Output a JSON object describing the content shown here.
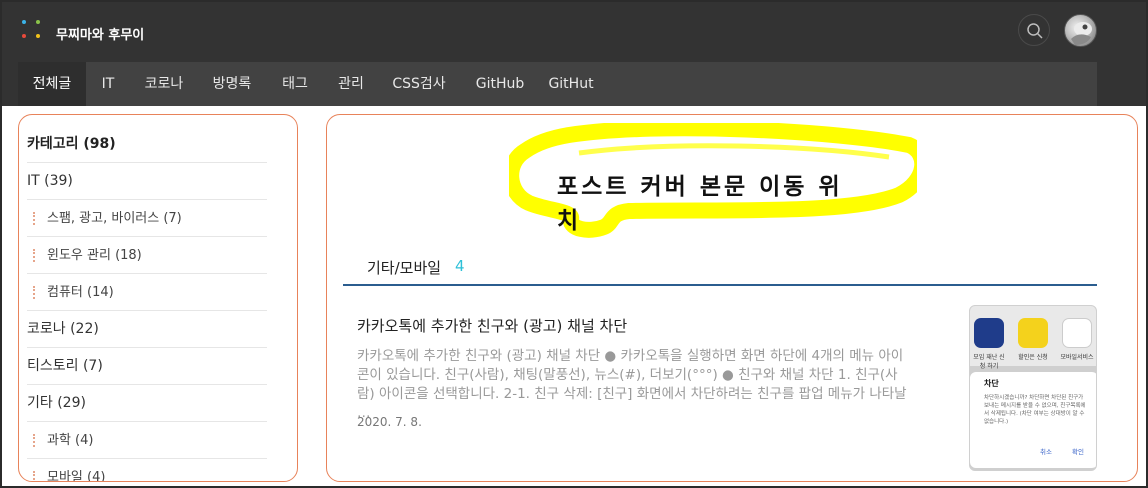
{
  "header": {
    "site_title": "무찌마와 후무이",
    "nav": [
      {
        "label": "전체글",
        "active": true
      },
      {
        "label": "IT"
      },
      {
        "label": "코로나"
      },
      {
        "label": "방명록"
      },
      {
        "label": "태그"
      },
      {
        "label": "관리"
      },
      {
        "label": "CSS검사"
      },
      {
        "label": "GitHub"
      },
      {
        "label": "GitHut"
      }
    ],
    "icons": {
      "search": "search-icon",
      "avatar": "avatar-image"
    }
  },
  "sidebar": {
    "categories": [
      {
        "label": "카테고리 (98)",
        "level": 0,
        "header": true
      },
      {
        "label": "IT (39)",
        "level": 0
      },
      {
        "label": "스팸, 광고, 바이러스 (7)",
        "level": 1
      },
      {
        "label": "윈도우 관리 (18)",
        "level": 1
      },
      {
        "label": "컴퓨터 (14)",
        "level": 1
      },
      {
        "label": "코로나 (22)",
        "level": 0
      },
      {
        "label": "티스토리 (7)",
        "level": 0
      },
      {
        "label": "기타 (29)",
        "level": 0
      },
      {
        "label": "과학 (4)",
        "level": 1
      },
      {
        "label": "모바일 (4)",
        "level": 1
      }
    ]
  },
  "main": {
    "cover_text": "포스트 커버 본문 이동 위치",
    "section": {
      "title": "기타/모바일",
      "count": "4"
    },
    "post": {
      "title": "카카오톡에 추가한 친구와 (광고) 채널 차단",
      "excerpt": "카카오톡에 추가한 친구와 (광고) 채널 차단 ● 카카오톡을 실행하면 화면 하단에 4개의 메뉴 아이콘이 있습니다. 친구(사람), 채팅(말풍선), 뉴스(#), 더보기(°°°) ● 친구와 채널 차단  1. 친구(사람) 아이콘을 선택합니다.  2-1. 친구 삭제: [친구] 화면에서 차단하려는 친구를 팝업 메뉴가 나타날 …",
      "date": "2020. 7. 8."
    },
    "thumbnail": {
      "apps": [
        "모임 재난 신청 하기",
        "할인은 신청",
        "모바일서비스"
      ],
      "dialog_title": "차단",
      "dialog_body": "차단하시겠습니까? 차단하면 차단된 친구가 보내는 메시지를 받을 수 없으며, 친구목록에서 삭제됩니다. (차단 여부는 상대방이 알 수 없습니다.)",
      "dialog_cancel": "취소",
      "dialog_ok": "확인"
    }
  },
  "colors": {
    "header_bg": "#333333",
    "nav_bg": "#424242",
    "panel_border": "#e8835a",
    "accent_count": "#2ec0d8",
    "section_line": "#2b5d8f",
    "highlight": "#ffff00"
  }
}
